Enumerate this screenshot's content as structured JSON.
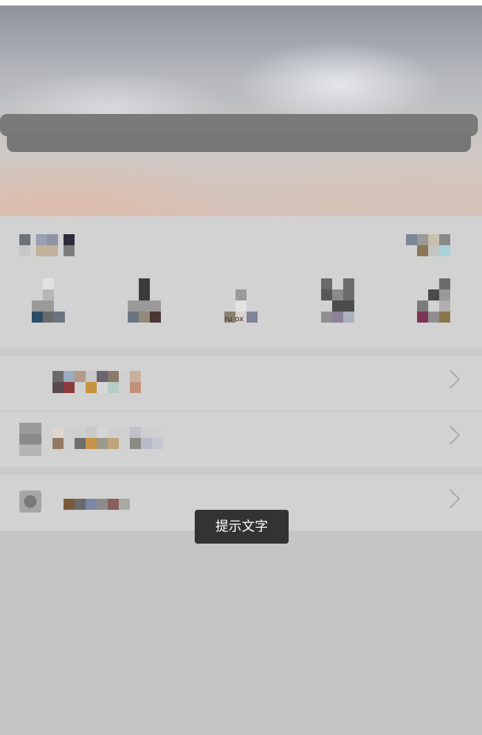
{
  "colors": {
    "background": "#c5c5c5",
    "panel": "#d2d2d2",
    "search_bar": "#7a7a7a",
    "toast_bg": "#333333",
    "toast_text": "#ffffff",
    "chevron": "#a9a9a9"
  },
  "quick_actions": [
    {
      "icon": "action-1-icon"
    },
    {
      "icon": "action-2-icon"
    },
    {
      "icon": "action-3-icon",
      "label": "ru ox"
    },
    {
      "icon": "action-4-icon"
    },
    {
      "icon": "action-5-icon"
    }
  ],
  "menu": [
    {
      "icon": "menu-item-1-icon",
      "chevron": "chevron-right-icon"
    },
    {
      "icon": "menu-item-2-icon",
      "chevron": "chevron-right-icon"
    },
    {
      "icon": "menu-item-3-icon",
      "chevron": "chevron-right-icon"
    }
  ],
  "toast": {
    "text": "提示文字"
  }
}
